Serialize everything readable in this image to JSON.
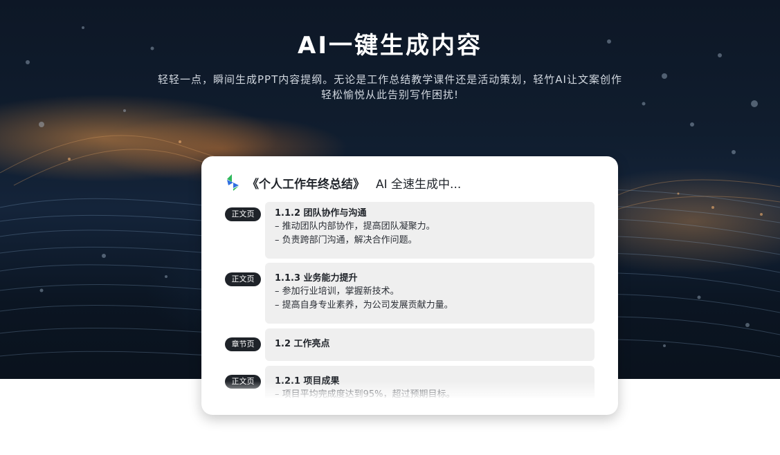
{
  "hero": {
    "headline": "AI一键生成内容",
    "subline_1": "轻轻一点，瞬间生成PPT内容提纲。无论是工作总结教学课件还是活动策划，轻竹AI让文案创作",
    "subline_2": "轻松愉悦从此告别写作困扰!"
  },
  "card": {
    "logo_icon": "qingzhu-logo-icon",
    "title": "《个人工作年终总结》",
    "status": "AI 全速生成中..."
  },
  "outline": [
    {
      "badge": "正文页",
      "title": "1.1.2 团队协作与沟通",
      "bullets": [
        "– 推动团队内部协作，提高团队凝聚力。",
        "– 负责跨部门沟通，解决合作问题。"
      ]
    },
    {
      "badge": "正文页",
      "title": "1.1.3 业务能力提升",
      "bullets": [
        "– 参加行业培训，掌握新技术。",
        "– 提高自身专业素养，为公司发展贡献力量。"
      ]
    },
    {
      "badge": "章节页",
      "title": "1.2 工作亮点",
      "bullets": []
    },
    {
      "badge": "正文页",
      "title": "1.2.1 项目成果",
      "bullets": [
        "– 项目平均完成度达到95%，超过预期目标。"
      ]
    }
  ],
  "colors": {
    "badge_bg": "#1f2329",
    "panel_bg": "#efefef",
    "logo_blue": "#2f6fe0",
    "logo_green": "#2eb85c"
  }
}
